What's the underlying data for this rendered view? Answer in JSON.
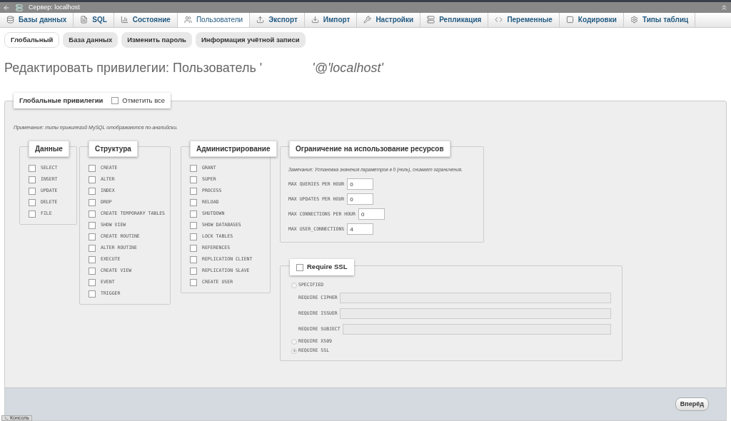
{
  "window": {
    "title": "Сервер: localhost"
  },
  "tabs": [
    {
      "label": "Базы данных",
      "selected": false
    },
    {
      "label": "SQL",
      "selected": false
    },
    {
      "label": "Состояние",
      "selected": false
    },
    {
      "label": "Пользователи",
      "selected": true
    },
    {
      "label": "Экспорт",
      "selected": false
    },
    {
      "label": "Импорт",
      "selected": false
    },
    {
      "label": "Настройки",
      "selected": false
    },
    {
      "label": "Репликация",
      "selected": false
    },
    {
      "label": "Переменные",
      "selected": false
    },
    {
      "label": "Кодировки",
      "selected": false
    },
    {
      "label": "Типы таблиц",
      "selected": false
    }
  ],
  "subtabs": [
    {
      "label": "Глобальный",
      "selected": true
    },
    {
      "label": "База данных",
      "selected": false
    },
    {
      "label": "Изменить пароль",
      "selected": false
    },
    {
      "label": "Информация учётной записи",
      "selected": false
    }
  ],
  "heading": {
    "prefix": "Редактировать привилегии: Пользователь '",
    "suffix": "'@'localhost'"
  },
  "global": {
    "legend": "Глобальные привилегии",
    "check_all": {
      "label": "Отметить все",
      "checked": false
    },
    "note": "Примечание: типы привилегий MySQL отображаются по-английски.",
    "groups": [
      {
        "title": "Данные",
        "items": [
          {
            "label": "SELECT",
            "checked": false
          },
          {
            "label": "INSERT",
            "checked": false
          },
          {
            "label": "UPDATE",
            "checked": false
          },
          {
            "label": "DELETE",
            "checked": false
          },
          {
            "label": "FILE",
            "checked": false
          }
        ]
      },
      {
        "title": "Структура",
        "items": [
          {
            "label": "CREATE",
            "checked": false
          },
          {
            "label": "ALTER",
            "checked": false
          },
          {
            "label": "INDEX",
            "checked": false
          },
          {
            "label": "DROP",
            "checked": false
          },
          {
            "label": "CREATE TEMPORARY TABLES",
            "checked": false
          },
          {
            "label": "SHOW VIEW",
            "checked": false
          },
          {
            "label": "CREATE ROUTINE",
            "checked": false
          },
          {
            "label": "ALTER ROUTINE",
            "checked": false
          },
          {
            "label": "EXECUTE",
            "checked": false
          },
          {
            "label": "CREATE VIEW",
            "checked": false
          },
          {
            "label": "EVENT",
            "checked": false
          },
          {
            "label": "TRIGGER",
            "checked": false
          }
        ]
      },
      {
        "title": "Администрирование",
        "items": [
          {
            "label": "GRANT",
            "checked": false
          },
          {
            "label": "SUPER",
            "checked": false
          },
          {
            "label": "PROCESS",
            "checked": false
          },
          {
            "label": "RELOAD",
            "checked": false
          },
          {
            "label": "SHUTDOWN",
            "checked": false
          },
          {
            "label": "SHOW DATABASES",
            "checked": false
          },
          {
            "label": "LOCK TABLES",
            "checked": false
          },
          {
            "label": "REFERENCES",
            "checked": false
          },
          {
            "label": "REPLICATION CLIENT",
            "checked": false
          },
          {
            "label": "REPLICATION SLAVE",
            "checked": false
          },
          {
            "label": "CREATE USER",
            "checked": false
          }
        ]
      }
    ]
  },
  "limits": {
    "title": "Ограничение на использование ресурсов",
    "note": "Замечание: Установка значения параметров в 0 (ноль), снимает ограничения.",
    "fields": [
      {
        "label": "MAX QUERIES PER HOUR",
        "value": "0"
      },
      {
        "label": "MAX UPDATES PER HOUR",
        "value": "0"
      },
      {
        "label": "MAX CONNECTIONS PER HOUR",
        "value": "0"
      },
      {
        "label": "MAX USER_CONNECTIONS",
        "value": "4"
      }
    ]
  },
  "ssl": {
    "label": "Require SSL",
    "checked": false,
    "options": [
      {
        "kind": "radio",
        "label": "SPECIFIED",
        "selected": false
      },
      {
        "kind": "field",
        "label": "REQUIRE CIPHER"
      },
      {
        "kind": "field",
        "label": "REQUIRE ISSUER"
      },
      {
        "kind": "field",
        "label": "REQUIRE SUBJECT"
      },
      {
        "kind": "radio",
        "label": "REQUIRE X509",
        "selected": false
      },
      {
        "kind": "radio",
        "label": "REQUIRE SSL",
        "selected": true
      }
    ]
  },
  "submit": "Вперёд",
  "console": "Консоль"
}
